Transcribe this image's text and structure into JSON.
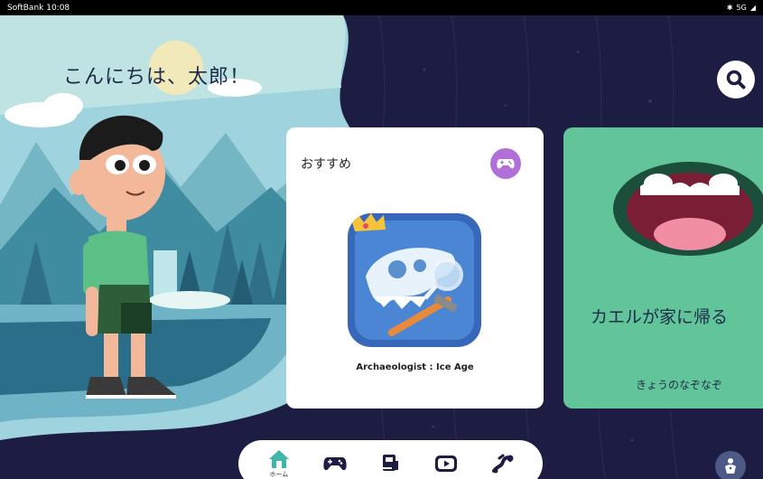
{
  "status_bar": {
    "carrier_time": "SoftBank 10:08",
    "indicators": "5G"
  },
  "greeting": "こんにちは、太郎！",
  "search": {
    "icon": "search-icon"
  },
  "recommend_card": {
    "title": "おすすめ",
    "badge_icon": "gamepad-icon",
    "app_name": "Archaeologist : Ice Age"
  },
  "riddle_card": {
    "title": "カエルが家に帰る",
    "subtitle": "きょうのなぞなぞ"
  },
  "nav": {
    "items": [
      {
        "label": "ホーム",
        "icon": "home-icon",
        "active": true
      },
      {
        "label": "",
        "icon": "gamepad-icon"
      },
      {
        "label": "",
        "icon": "book-icon"
      },
      {
        "label": "",
        "icon": "video-icon"
      },
      {
        "label": "",
        "icon": "creative-icon"
      }
    ]
  },
  "colors": {
    "night_bg": "#1d1c43",
    "card_green": "#62c59a",
    "badge_purple": "#b070d8",
    "nav_teal": "#3fb6a8"
  }
}
